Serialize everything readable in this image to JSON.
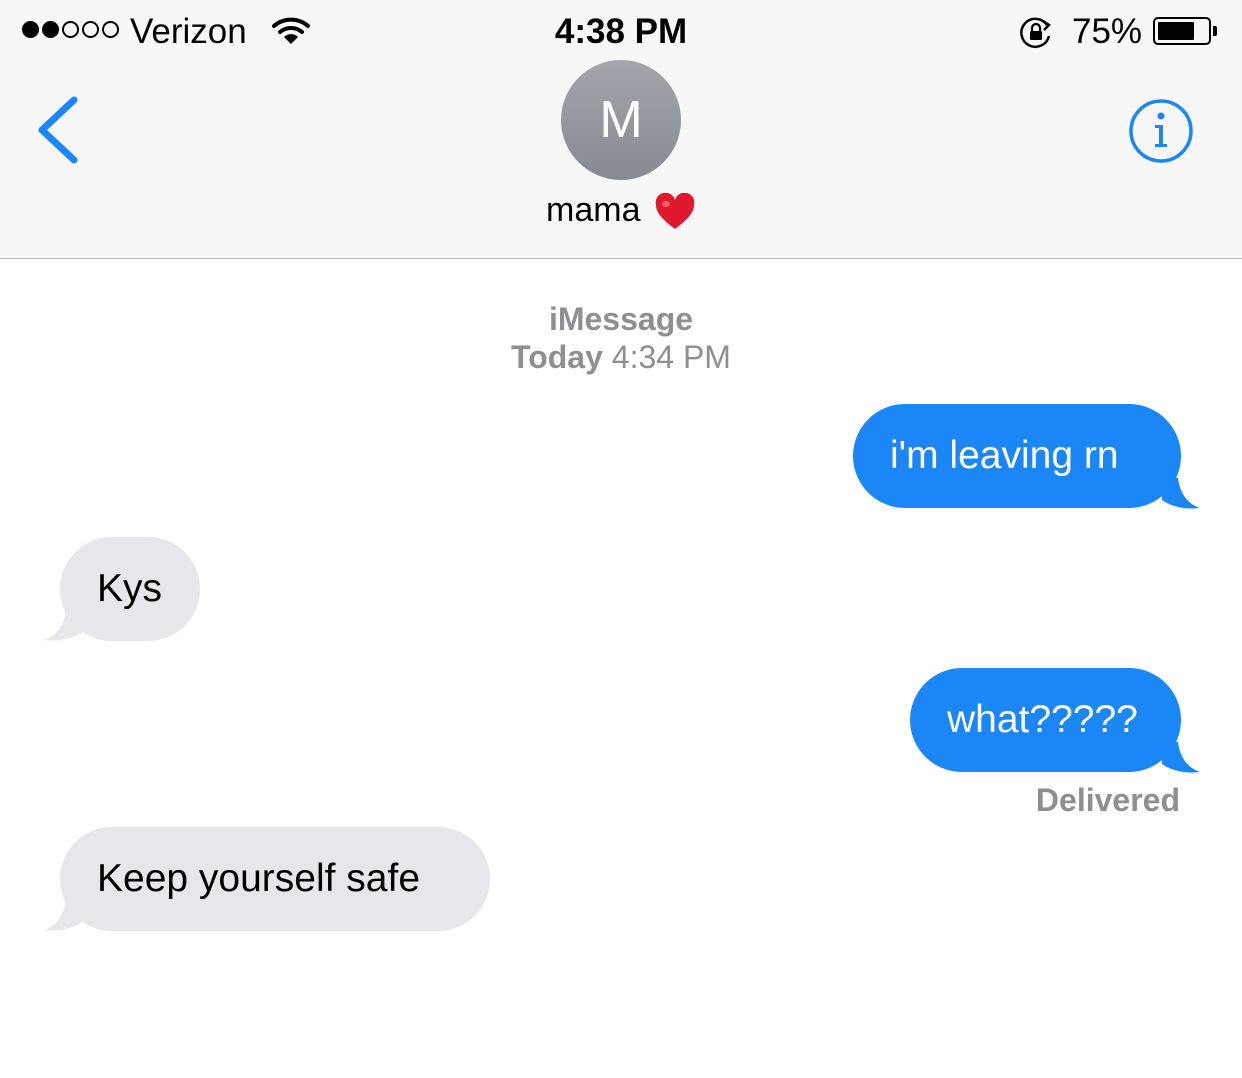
{
  "status_bar": {
    "signal_dots_filled": 2,
    "signal_dots_total": 5,
    "carrier": "Verizon",
    "time": "4:38 PM",
    "battery_percent_label": "75%",
    "battery_level": 0.75
  },
  "nav": {
    "avatar_initial": "M",
    "contact_name": "mama",
    "back_icon": "chevron-left-icon",
    "info_icon": "info-icon",
    "accent_color": "#1a86f8"
  },
  "conversation": {
    "service": "iMessage",
    "date_day": "Today",
    "date_time": "4:34 PM",
    "messages": [
      {
        "direction": "outgoing",
        "text": "i'm leaving rn"
      },
      {
        "direction": "incoming",
        "text": "Kys"
      },
      {
        "direction": "outgoing",
        "text": "what?????"
      },
      {
        "direction": "incoming",
        "text": "Keep yourself safe"
      }
    ],
    "delivered_label": "Delivered"
  },
  "colors": {
    "outgoing_bubble": "#1a86f8",
    "incoming_bubble": "#e6e6eb",
    "meta_text": "#8e8e93",
    "heart": "#e0182d"
  }
}
